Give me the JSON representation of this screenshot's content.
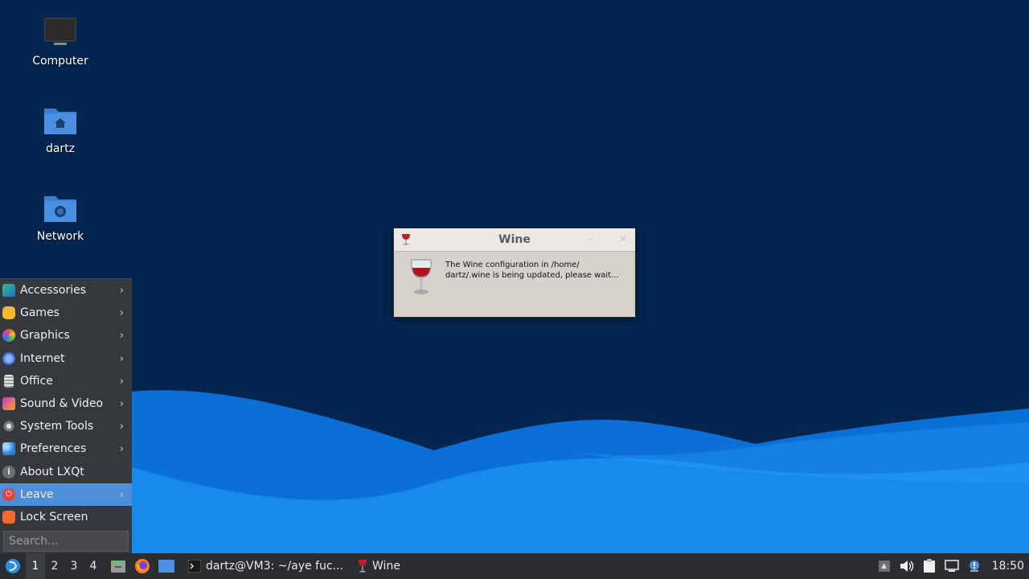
{
  "desktop": {
    "icons": [
      {
        "label": "Computer",
        "icon": "computer-icon"
      },
      {
        "label": "dartz",
        "icon": "home-folder-icon"
      },
      {
        "label": "Network",
        "icon": "network-folder-icon"
      }
    ]
  },
  "wine_dialog": {
    "title": "Wine",
    "message_line1": "The Wine configuration in /home/",
    "message_line2": "dartz/.wine is being updated, please wait..."
  },
  "start_menu": {
    "items": [
      {
        "label": "Accessories",
        "icon": "accessories-icon",
        "submenu": true
      },
      {
        "label": "Games",
        "icon": "games-icon",
        "submenu": true
      },
      {
        "label": "Graphics",
        "icon": "graphics-icon",
        "submenu": true
      },
      {
        "label": "Internet",
        "icon": "internet-icon",
        "submenu": true
      },
      {
        "label": "Office",
        "icon": "office-icon",
        "submenu": true
      },
      {
        "label": "Sound & Video",
        "icon": "sound-video-icon",
        "submenu": true
      },
      {
        "label": "System Tools",
        "icon": "system-tools-icon",
        "submenu": true
      },
      {
        "label": "Preferences",
        "icon": "preferences-icon",
        "submenu": true
      },
      {
        "label": "About LXQt",
        "icon": "info-icon",
        "submenu": false
      },
      {
        "label": "Leave",
        "icon": "power-icon",
        "submenu": true,
        "highlighted": true
      },
      {
        "label": "Lock Screen",
        "icon": "lock-icon",
        "submenu": false
      }
    ],
    "search_placeholder": "Search..."
  },
  "taskbar": {
    "desktops": [
      "1",
      "2",
      "3",
      "4"
    ],
    "current_desktop": "1",
    "tasks": [
      {
        "label": "dartz@VM3: ~/aye fuc...",
        "icon": "terminal-icon"
      },
      {
        "label": "Wine",
        "icon": "wine-icon"
      }
    ],
    "clock": "18:50"
  },
  "colors": {
    "desktop_bg": "#032550",
    "wave_light": "#1a8fef",
    "wave_dark": "#0a6fd6",
    "menu_bg": "#35383c",
    "menu_highlight": "#4f8ed9",
    "taskbar_bg": "#2b2d31"
  }
}
